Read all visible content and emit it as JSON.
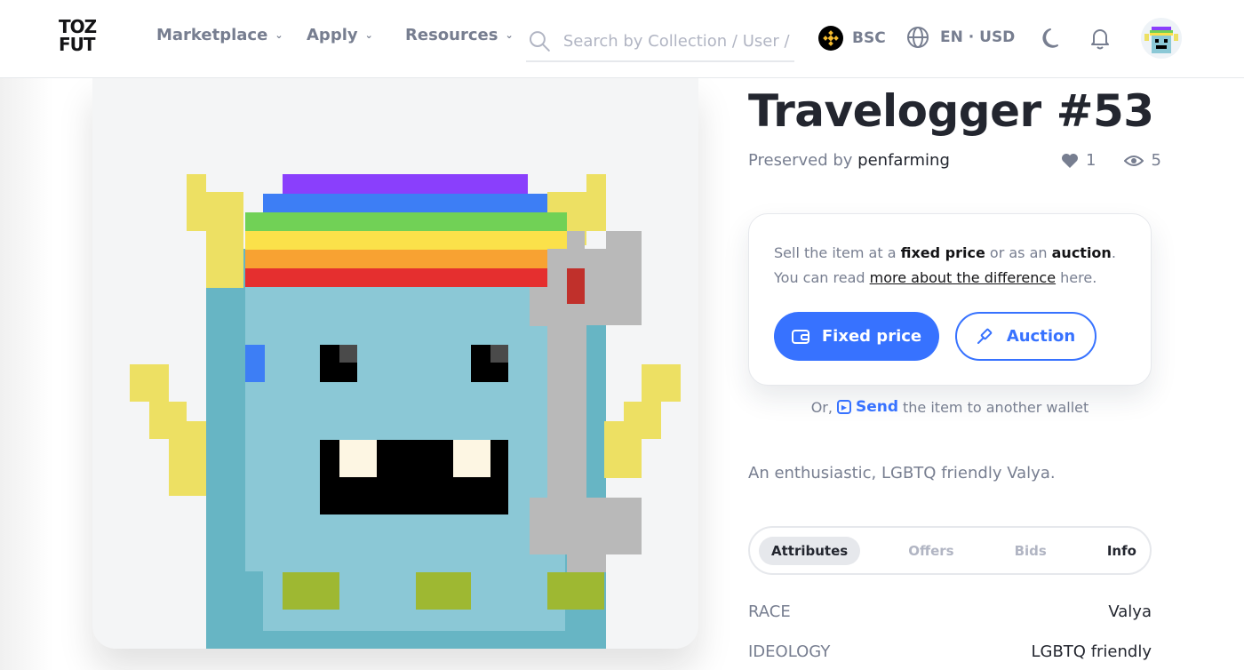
{
  "header": {
    "logo_line1": "TOZ",
    "logo_line2": "FUT",
    "nav": [
      {
        "label": "Marketplace"
      },
      {
        "label": "Apply"
      },
      {
        "label": "Resources"
      }
    ],
    "search_placeholder": "Search by Collection / User / Address",
    "chain": "BSC",
    "language_currency": "EN · USD",
    "icons": [
      "search-icon",
      "bnb-icon",
      "globe-icon",
      "moon-icon",
      "bell-icon",
      "avatar"
    ]
  },
  "item": {
    "title": "Travelogger #53",
    "preserved_prefix": "Preserved by",
    "owner": "penfarming",
    "likes": "1",
    "views": "5",
    "description": "An enthusiastic, LGBTQ friendly Valya."
  },
  "sell": {
    "text_1": "Sell the item at a ",
    "fixed_price_bold": "fixed price",
    "text_2": " or as an ",
    "auction_bold": "auction",
    "text_3": ". You can read ",
    "link": "more about the difference",
    "text_4": " here.",
    "fixed_button": "Fixed price",
    "auction_button": "Auction",
    "or_prefix": "Or,",
    "send_label": "Send",
    "send_suffix": "the item to another wallet"
  },
  "tabs": [
    {
      "label": "Attributes",
      "active": true
    },
    {
      "label": "Offers"
    },
    {
      "label": "Bids"
    },
    {
      "label": "Info"
    }
  ],
  "attributes": [
    {
      "key": "Race",
      "value": "Valya"
    },
    {
      "key": "Ideology",
      "value": "LGBTQ friendly"
    }
  ],
  "colors": {
    "accent": "#3772ff",
    "text_dark": "#23262f",
    "text_muted": "#777e90",
    "border": "#e6e8ec"
  }
}
